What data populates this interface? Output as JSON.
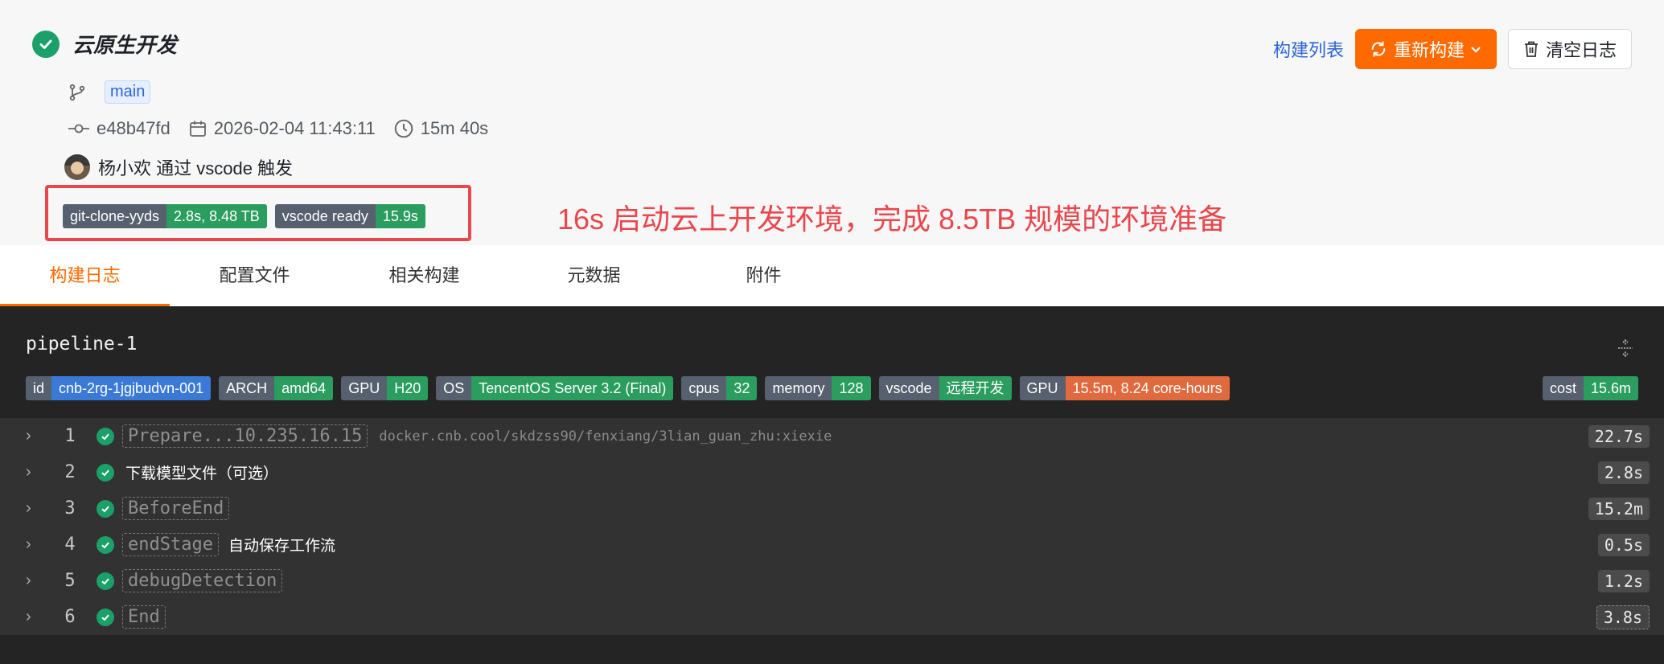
{
  "build": {
    "title": "云原生开发",
    "branch": "main",
    "commit": "e48b47fd",
    "datetime": "2026-02-04 11:43:11",
    "duration": "15m 40s",
    "trigger": "杨小欢 通过 vscode 触发"
  },
  "top_badges": [
    {
      "key": "git-clone-yyds",
      "value": "2.8s, 8.48 TB",
      "color": "#2a9d5f"
    },
    {
      "key": "vscode ready",
      "value": "15.9s",
      "color": "#2a9d5f"
    }
  ],
  "annotation": "16s 启动云上开发环境，完成 8.5TB 规模的环境准备",
  "actions": {
    "build_list": "构建列表",
    "rebuild": "重新构建",
    "clear_log": "清空日志"
  },
  "tabs": [
    "构建日志",
    "配置文件",
    "相关构建",
    "元数据",
    "附件"
  ],
  "pipeline": {
    "name": "pipeline-1",
    "badges": [
      {
        "key": "id",
        "value": "cnb-2rg-1jgjbudvn-001",
        "color": "#3a79d6"
      },
      {
        "key": "ARCH",
        "value": "amd64",
        "color": "#2a9d5f"
      },
      {
        "key": "GPU",
        "value": "H20",
        "color": "#2a9d5f"
      },
      {
        "key": "OS",
        "value": "TencentOS Server 3.2 (Final)",
        "color": "#2a9d5f"
      },
      {
        "key": "cpus",
        "value": "32",
        "color": "#2a9d5f"
      },
      {
        "key": "memory",
        "value": "128",
        "color": "#2a9d5f"
      },
      {
        "key": "vscode",
        "value": "远程开发",
        "color": "#2a9d5f"
      },
      {
        "key": "GPU",
        "value": "15.5m, 8.24 core-hours",
        "color": "#e0693d"
      }
    ],
    "cost": {
      "key": "cost",
      "value": "15.6m"
    },
    "steps": [
      {
        "num": "1",
        "name": "Prepare...10.235.16.15",
        "image": "docker.cnb.cool/skdzss90/fenxiang/3lian_guan_zhu:xiexie",
        "duration": "22.7s"
      },
      {
        "num": "2",
        "label": "下载模型文件（可选）",
        "duration": "2.8s"
      },
      {
        "num": "3",
        "name": "BeforeEnd",
        "duration": "15.2m"
      },
      {
        "num": "4",
        "name": "endStage",
        "desc": "自动保存工作流",
        "duration": "0.5s"
      },
      {
        "num": "5",
        "name": "debugDetection",
        "duration": "1.2s"
      },
      {
        "num": "6",
        "name": "End",
        "duration": "3.8s"
      }
    ]
  }
}
